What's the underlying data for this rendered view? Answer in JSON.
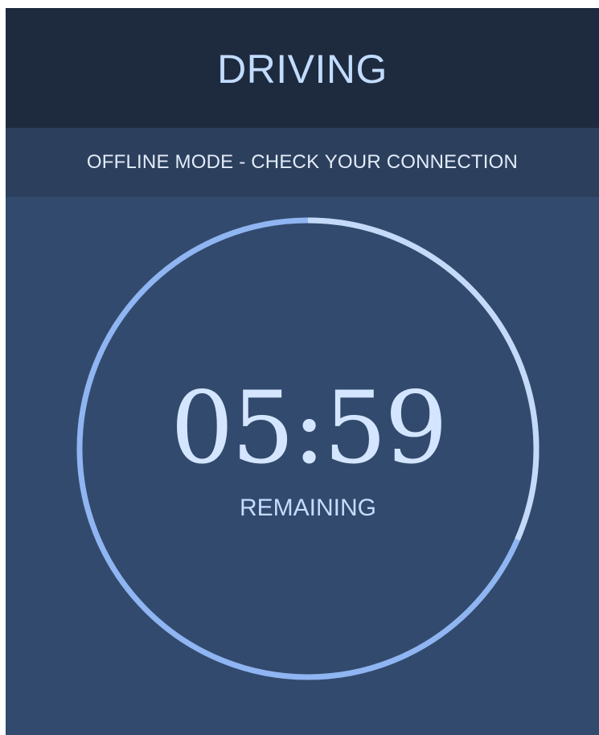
{
  "header": {
    "title": "DRIVING"
  },
  "banner": {
    "text": "OFFLINE MODE - CHECK YOUR CONNECTION"
  },
  "timer": {
    "time": "05:59",
    "label": "REMAINING",
    "elapsed_fraction": 0.315
  },
  "colors": {
    "header_bg": "#1e2a3e",
    "banner_bg": "#2c3f5d",
    "main_bg": "#324a6d",
    "ring_remaining": "#8fb5f2",
    "ring_elapsed": "#c4daf8",
    "text": "#c2dcff"
  }
}
